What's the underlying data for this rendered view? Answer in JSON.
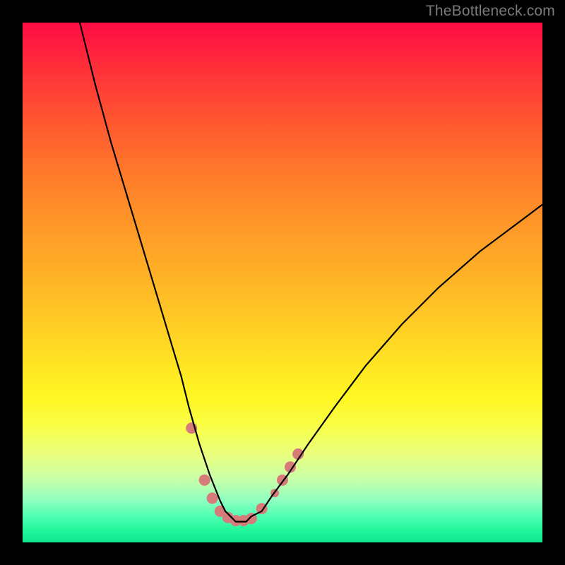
{
  "watermark": {
    "text": "TheBottleneck.com"
  },
  "chart_data": {
    "type": "line",
    "title": "",
    "xlabel": "",
    "ylabel": "",
    "xlim": [
      0,
      100
    ],
    "ylim": [
      0,
      100
    ],
    "series": [
      {
        "name": "bottleneck-curve",
        "x": [
          11,
          14,
          17,
          20,
          23,
          26,
          29,
          30.5,
          32,
          34,
          36,
          38,
          39,
          40,
          41,
          42,
          43,
          44,
          46,
          48,
          51,
          55,
          60,
          66,
          73,
          80,
          88,
          96,
          100
        ],
        "y": [
          100,
          88,
          77,
          67,
          57,
          47,
          37,
          32,
          26,
          19,
          13,
          8,
          6,
          5,
          4,
          4,
          4,
          5,
          6,
          9,
          13,
          19,
          26,
          34,
          42,
          49,
          56,
          62,
          65
        ],
        "stroke": "#000000",
        "stroke_width": 2.2
      }
    ],
    "markers": [
      {
        "x": 32.5,
        "y": 22,
        "r": 8,
        "fill": "#d77b7a"
      },
      {
        "x": 35.0,
        "y": 12,
        "r": 8,
        "fill": "#d77b7a"
      },
      {
        "x": 36.5,
        "y": 8.5,
        "r": 8,
        "fill": "#d77b7a"
      },
      {
        "x": 38.0,
        "y": 6.0,
        "r": 8,
        "fill": "#d77b7a"
      },
      {
        "x": 39.5,
        "y": 4.8,
        "r": 8,
        "fill": "#d77b7a"
      },
      {
        "x": 41.0,
        "y": 4.2,
        "r": 8,
        "fill": "#d77b7a"
      },
      {
        "x": 42.5,
        "y": 4.2,
        "r": 8,
        "fill": "#d77b7a"
      },
      {
        "x": 44.0,
        "y": 4.6,
        "r": 8,
        "fill": "#d77b7a"
      },
      {
        "x": 46.0,
        "y": 6.5,
        "r": 8,
        "fill": "#d77b7a"
      },
      {
        "x": 48.5,
        "y": 9.5,
        "r": 6,
        "fill": "#d77b7a"
      },
      {
        "x": 50.0,
        "y": 12.0,
        "r": 8,
        "fill": "#d77b7a"
      },
      {
        "x": 51.5,
        "y": 14.5,
        "r": 8,
        "fill": "#d77b7a"
      },
      {
        "x": 53.0,
        "y": 17.0,
        "r": 8,
        "fill": "#d77b7a"
      }
    ]
  }
}
